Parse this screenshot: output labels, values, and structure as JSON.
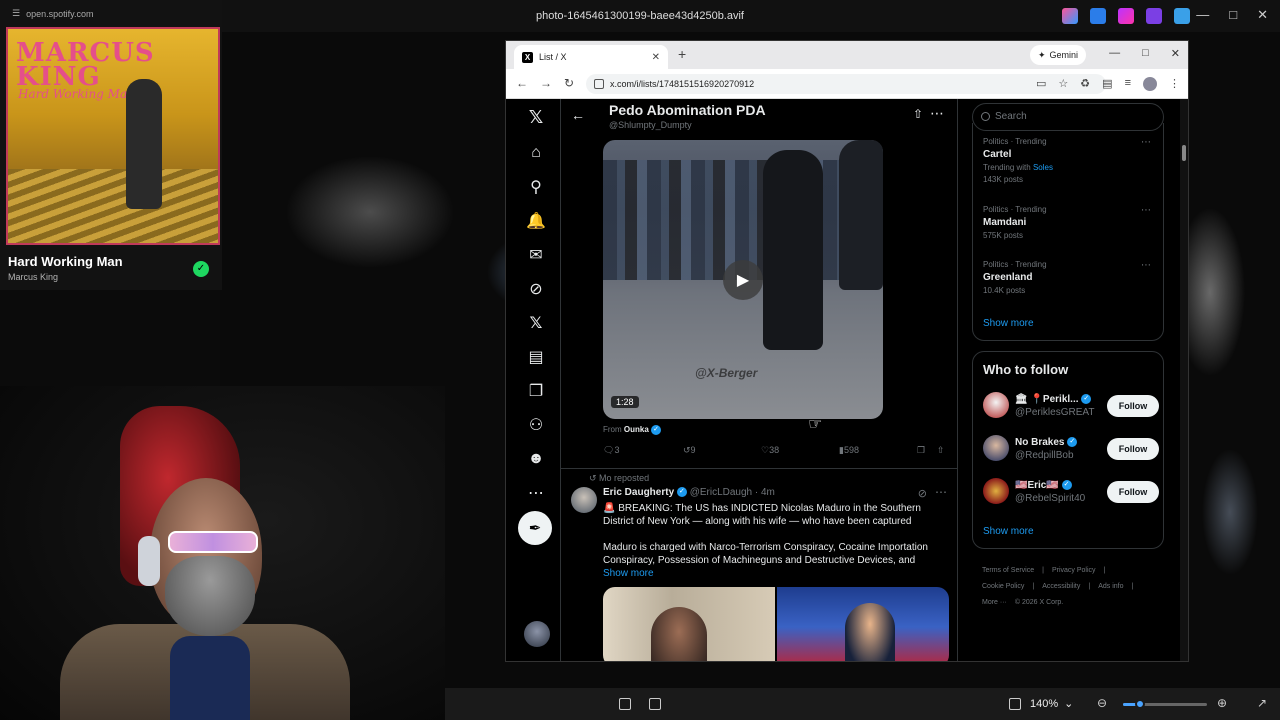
{
  "viewer": {
    "file_title": "photo-1645461300199-baee43d4250b.avif",
    "zoom": "140%",
    "zoom_fraction": 0.2
  },
  "spotify": {
    "url": "open.spotify.com",
    "album_title": "MARCUS KING",
    "album_sub": "Hard Working Man",
    "track": "Hard Working Man",
    "artist": "Marcus King"
  },
  "browser": {
    "tab_title": "List / X",
    "url": "x.com/i/lists/1748151516920270912",
    "gemini_label": "Gemini"
  },
  "x": {
    "header": {
      "title": "Pedo Abomination PDA",
      "handle": "@Shlumpty_Dumpty"
    },
    "video": {
      "watermark": "@X-Berger",
      "duration": "1:28",
      "from_label": "From",
      "from_name": "Ounka"
    },
    "actions": {
      "replies": "3",
      "reposts": "9",
      "likes": "38",
      "views": "598"
    },
    "post": {
      "reposted_label": "Mo reposted",
      "author": "Eric Daugherty",
      "handle": "@EricLDaugh",
      "time": "· 4m",
      "para1": "🚨 BREAKING: The US has INDICTED Nicolas Maduro in the Southern District of New York — along with his wife — who have been captured",
      "para2": "Maduro is charged with Narco-Terrorism Conspiracy, Cocaine Importation Conspiracy, Possession of Machineguns and Destructive Devices, and",
      "show_more": "Show more"
    },
    "search_placeholder": "Search",
    "trends": [
      {
        "category": "Politics · Trending",
        "name": "Cartel",
        "meta_prefix": "Trending with ",
        "meta_highlight": "Soles",
        "posts": "143K posts"
      },
      {
        "category": "Politics · Trending",
        "name": "Mamdani",
        "posts": "575K posts"
      },
      {
        "category": "Politics · Trending",
        "name": "Greenland",
        "posts": "10.4K posts"
      }
    ],
    "trends_show_more": "Show more",
    "who_to_follow": {
      "title": "Who to follow",
      "users": [
        {
          "name": "🏛 📍Perikl...",
          "handle": "@PeriklesGREAT",
          "button": "Follow"
        },
        {
          "name": "No Brakes",
          "handle": "@RedpillBob",
          "button": "Follow"
        },
        {
          "name": "🇺🇸Eric🇺🇸",
          "handle": "@RebelSpirit40",
          "button": "Follow"
        }
      ],
      "show_more": "Show more"
    },
    "footer": {
      "links": [
        "Terms of Service",
        "|",
        "Privacy Policy",
        "|",
        "Cookie Policy",
        "|",
        "Accessibility",
        "|",
        "Ads info",
        "|",
        "More ···",
        "© 2026 X Corp."
      ]
    }
  }
}
